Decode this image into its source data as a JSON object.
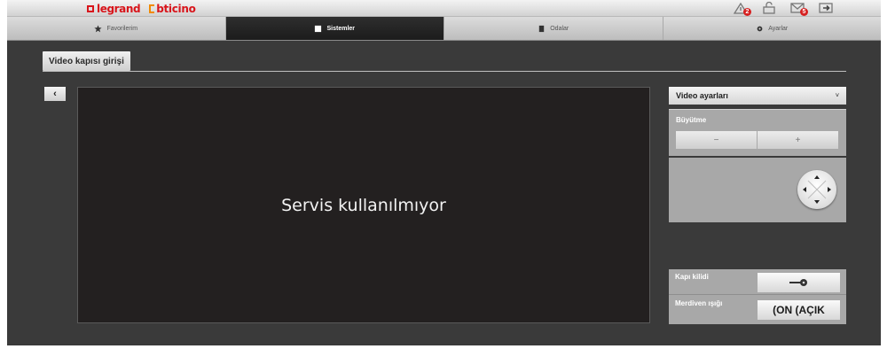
{
  "brand": {
    "logo1": "legrand",
    "logo2": "bticino"
  },
  "header_icons": [
    {
      "name": "alarm-icon",
      "badge": "2"
    },
    {
      "name": "lock-icon",
      "badge": ""
    },
    {
      "name": "mail-icon",
      "badge": "5"
    },
    {
      "name": "logout-icon",
      "badge": ""
    }
  ],
  "nav": {
    "tabs": [
      {
        "label": "Favorilerim",
        "icon": "star-icon",
        "active": false
      },
      {
        "label": "Sistemler",
        "icon": "systems-icon",
        "active": true
      },
      {
        "label": "Odalar",
        "icon": "rooms-icon",
        "active": false
      },
      {
        "label": "Ayarlar",
        "icon": "settings-icon",
        "active": false
      }
    ]
  },
  "page": {
    "tab_title": "Video kapısı girişi",
    "back_label": "‹"
  },
  "video": {
    "message": "Servis kullanılmıyor"
  },
  "video_settings": {
    "title": "Video ayarları",
    "chevron": "˅",
    "zoom_label": "Büyütme",
    "zoom_minus": "−",
    "zoom_plus": "+"
  },
  "door": {
    "lock_label": "Kapı kilidi",
    "stairs_label": "Merdiven ışığı",
    "stairs_button": "(ON (AÇIK"
  },
  "colors": {
    "accent": "#d8151b",
    "badge": "#d62020",
    "background": "#3a3a3a"
  }
}
